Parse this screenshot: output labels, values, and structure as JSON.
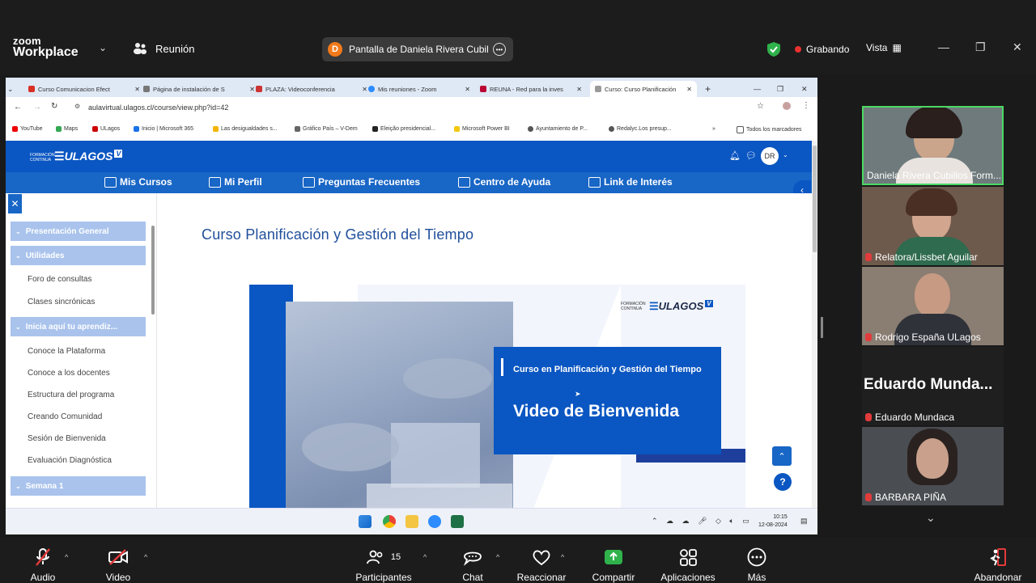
{
  "zoom": {
    "logo_line1": "zoom",
    "logo_line2": "Workplace",
    "meeting_label": "Reunión",
    "share_initial": "D",
    "share_label": "Pantalla de Daniela Rivera Cubillc",
    "recording_label": "Grabando",
    "view_label": "Vista",
    "colors": {
      "background": "#1c1c1c",
      "recording": "#e8312f",
      "share_avatar": "#f27a1a",
      "speaker_border": "#4cd964"
    }
  },
  "browser": {
    "tabs": [
      {
        "label": "Curso Comunicacion Efect",
        "icon": "gmail-icon"
      },
      {
        "label": "Página de instalación de S",
        "icon": "page-icon"
      },
      {
        "label": "PLAZA: Videoconferencia",
        "icon": "page-icon"
      },
      {
        "label": "Mis reuniones - Zoom",
        "icon": "zoom-icon"
      },
      {
        "label": "REUNA - Red para la inves",
        "icon": "page-icon"
      },
      {
        "label": "Curso: Curso Planificación",
        "icon": "page-icon"
      }
    ],
    "address": "aulavirtual.ulagos.cl/course/view.php?id=42",
    "bookmarks": [
      "YouTube",
      "Maps",
      "ULagos",
      "Inicio | Microsoft 365",
      "Las desigualdades s...",
      "Gráfico País – V-Dem",
      "Eleição presidencial...",
      "Microsoft Power BI",
      "Ayuntamiento de P...",
      "Redalyc.Los presup..."
    ],
    "bookmarks_folder": "Todos los marcadores"
  },
  "site": {
    "logo_small": "FORMACIÓN CONTINUA",
    "logo_text": "ULAGOS",
    "user_initials": "DR",
    "nav": [
      "Mis Cursos",
      "Mi Perfil",
      "Preguntas Frecuentes",
      "Centro de Ayuda",
      "Link de Interés"
    ],
    "sidebar": [
      {
        "type": "section",
        "label": "Presentación General"
      },
      {
        "type": "section",
        "label": "Utilidades"
      },
      {
        "type": "item",
        "label": "Foro de consultas"
      },
      {
        "type": "item",
        "label": "Clases sincrónicas"
      },
      {
        "type": "section",
        "label": "Inicia aquí tu aprendiz..."
      },
      {
        "type": "item",
        "label": "Conoce la Plataforma"
      },
      {
        "type": "item",
        "label": "Conoce a los docentes"
      },
      {
        "type": "item",
        "label": "Estructura del programa"
      },
      {
        "type": "item",
        "label": "Creando Comunidad"
      },
      {
        "type": "item",
        "label": "Sesión de Bienvenida"
      },
      {
        "type": "item",
        "label": "Evaluación Diagnóstica"
      },
      {
        "type": "section",
        "label": "Semana 1"
      }
    ],
    "course_title": "Curso Planificación y Gestión del Tiempo",
    "hero_logo_small": "FORMACIÓN CONTINUA",
    "hero_logo_text": "ULAGOS",
    "hero_subtitle": "Curso en Planificación y Gestión del Tiempo",
    "hero_title": "Video de Bienvenida",
    "colors": {
      "primary": "#0a56c2",
      "nav": "#1866c6",
      "section": "#a9c3ec",
      "title": "#1f4f9b"
    }
  },
  "taskbar": {
    "time": "10:15",
    "date": "12-08-2024"
  },
  "participants": [
    {
      "name": "Daniela Rivera Cubillos Form...",
      "muted": false,
      "speaking": true
    },
    {
      "name": "Relatora/Lissbet Aguilar",
      "muted": true
    },
    {
      "name": "Rodrigo España  ULagos",
      "muted": true
    },
    {
      "name": "Eduardo Mundaca",
      "muted": true,
      "video": false,
      "big_name": "Eduardo  Munda..."
    },
    {
      "name": "BARBARA PIÑA",
      "muted": true
    }
  ],
  "toolbar": {
    "audio": "Audio",
    "video": "Video",
    "participants_count": "15",
    "participants": "Participantes",
    "chat": "Chat",
    "react": "Reaccionar",
    "share": "Compartir",
    "apps": "Aplicaciones",
    "more": "Más",
    "leave": "Abandonar"
  }
}
